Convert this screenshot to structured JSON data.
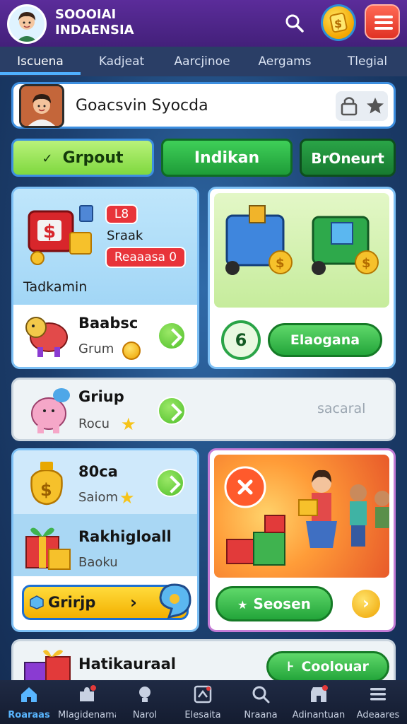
{
  "header": {
    "brand_line1": "SOOOIAI",
    "brand_line2": "INDAENSIA"
  },
  "tabs": [
    {
      "label": "Iscuena",
      "active": true
    },
    {
      "label": "Kadjeat",
      "active": false
    },
    {
      "label": "Aarcjinoe",
      "active": false
    },
    {
      "label": "Aergams",
      "active": false
    },
    {
      "label": "Tlegial",
      "active": false
    }
  ],
  "profile": {
    "name": "Goacsvin Syocda"
  },
  "filters": [
    {
      "label": "Grpout",
      "check": "✓"
    },
    {
      "label": "Indikan"
    },
    {
      "label": "BrOneurt"
    }
  ],
  "card_a": {
    "badge_top": "L8",
    "label": "Sraak",
    "badge_bottom": "Reaaasa 0",
    "caption": "Tadkamin",
    "item_title": "Baabsc",
    "item_sub": "Grum"
  },
  "card_b": {
    "circle_label": "6",
    "button_label": "Elaogana"
  },
  "card_c": {
    "title": "Griup",
    "sub": "Rocu",
    "right_text": "sacaral"
  },
  "card_d": {
    "row1_title": "80ca",
    "row1_sub": "Saiom",
    "row2_title": "Rakhigloall",
    "row2_sub": "Baoku",
    "button_label": "Grirjp"
  },
  "card_e": {
    "button_label": "Seosen"
  },
  "card_f": {
    "title": "Hatikauraal",
    "button_label": "Coolouar"
  },
  "bottom_nav": [
    {
      "label": "Roaraas",
      "icon": "home-icon",
      "active": true
    },
    {
      "label": "Mlagidenama",
      "icon": "puzzle-icon",
      "active": false
    },
    {
      "label": "Narol",
      "icon": "bulb-icon",
      "active": false
    },
    {
      "label": "Elesaita",
      "icon": "card-icon",
      "active": false
    },
    {
      "label": "Nraana",
      "icon": "search-icon",
      "active": false
    },
    {
      "label": "Adinantuan",
      "icon": "shop-icon",
      "active": false
    },
    {
      "label": "Adeaares",
      "icon": "menu-icon",
      "active": false
    }
  ],
  "colors": {
    "header_bg": "#4a2384",
    "accent_blue": "#3d8fe0",
    "green": "#2fb347",
    "red": "#e8343a",
    "yellow": "#f6c318"
  }
}
